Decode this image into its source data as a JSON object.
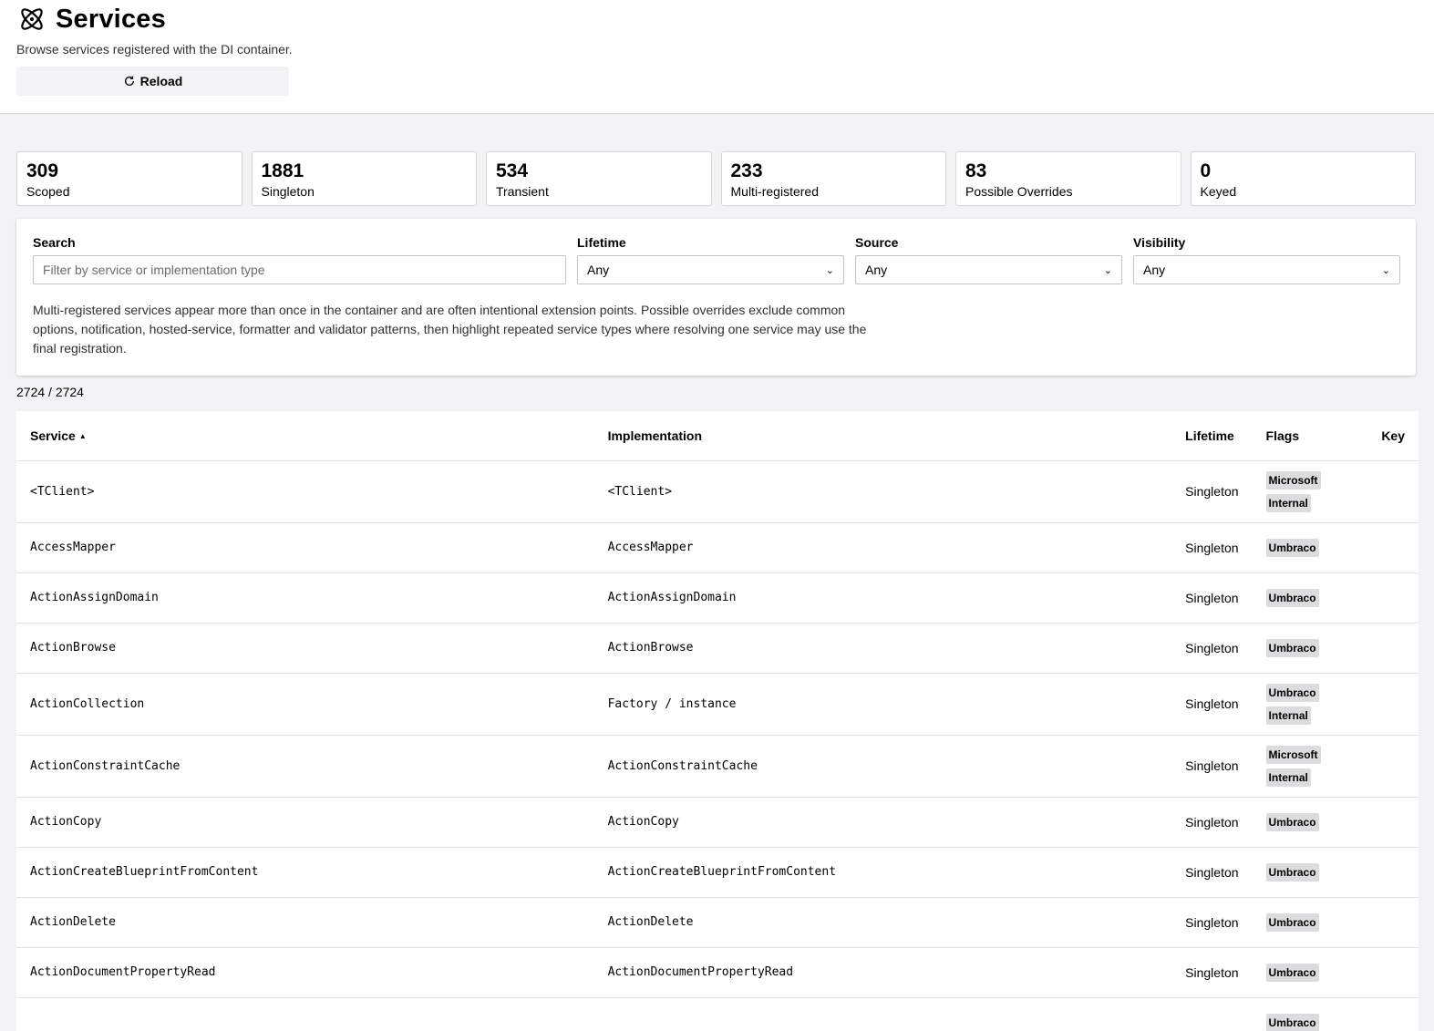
{
  "header": {
    "title": "Services",
    "subtitle": "Browse services registered with the DI container.",
    "reload_label": "Reload"
  },
  "stats": [
    {
      "value": "309",
      "label": "Scoped"
    },
    {
      "value": "1881",
      "label": "Singleton"
    },
    {
      "value": "534",
      "label": "Transient"
    },
    {
      "value": "233",
      "label": "Multi-registered"
    },
    {
      "value": "83",
      "label": "Possible Overrides"
    },
    {
      "value": "0",
      "label": "Keyed"
    }
  ],
  "filters": {
    "search_label": "Search",
    "search_placeholder": "Filter by service or implementation type",
    "search_value": "",
    "lifetime_label": "Lifetime",
    "lifetime_value": "Any",
    "source_label": "Source",
    "source_value": "Any",
    "visibility_label": "Visibility",
    "visibility_value": "Any",
    "info": "Multi-registered services appear more than once in the container and are often intentional extension points. Possible overrides exclude common options, notification, hosted-service, formatter and validator patterns, then highlight repeated service types where resolving one service may use the final registration."
  },
  "count_text": "2724 / 2724",
  "table": {
    "columns": {
      "service": "Service",
      "implementation": "Implementation",
      "lifetime": "Lifetime",
      "flags": "Flags",
      "key": "Key"
    },
    "rows": [
      {
        "service": "<TClient>",
        "implementation": "<TClient>",
        "lifetime": "Singleton",
        "flags": [
          "Microsoft",
          "Internal"
        ],
        "key": ""
      },
      {
        "service": "AccessMapper",
        "implementation": "AccessMapper",
        "lifetime": "Singleton",
        "flags": [
          "Umbraco"
        ],
        "key": ""
      },
      {
        "service": "ActionAssignDomain",
        "implementation": "ActionAssignDomain",
        "lifetime": "Singleton",
        "flags": [
          "Umbraco"
        ],
        "key": ""
      },
      {
        "service": "ActionBrowse",
        "implementation": "ActionBrowse",
        "lifetime": "Singleton",
        "flags": [
          "Umbraco"
        ],
        "key": ""
      },
      {
        "service": "ActionCollection",
        "implementation": "Factory / instance",
        "lifetime": "Singleton",
        "flags": [
          "Umbraco",
          "Internal"
        ],
        "key": ""
      },
      {
        "service": "ActionConstraintCache",
        "implementation": "ActionConstraintCache",
        "lifetime": "Singleton",
        "flags": [
          "Microsoft",
          "Internal"
        ],
        "key": ""
      },
      {
        "service": "ActionCopy",
        "implementation": "ActionCopy",
        "lifetime": "Singleton",
        "flags": [
          "Umbraco"
        ],
        "key": ""
      },
      {
        "service": "ActionCreateBlueprintFromContent",
        "implementation": "ActionCreateBlueprintFromContent",
        "lifetime": "Singleton",
        "flags": [
          "Umbraco"
        ],
        "key": ""
      },
      {
        "service": "ActionDelete",
        "implementation": "ActionDelete",
        "lifetime": "Singleton",
        "flags": [
          "Umbraco"
        ],
        "key": ""
      },
      {
        "service": "ActionDocumentPropertyRead",
        "implementation": "ActionDocumentPropertyRead",
        "lifetime": "Singleton",
        "flags": [
          "Umbraco"
        ],
        "key": ""
      },
      {
        "service": "",
        "implementation": "",
        "lifetime": "",
        "flags": [
          "Umbraco"
        ],
        "key": ""
      }
    ]
  }
}
